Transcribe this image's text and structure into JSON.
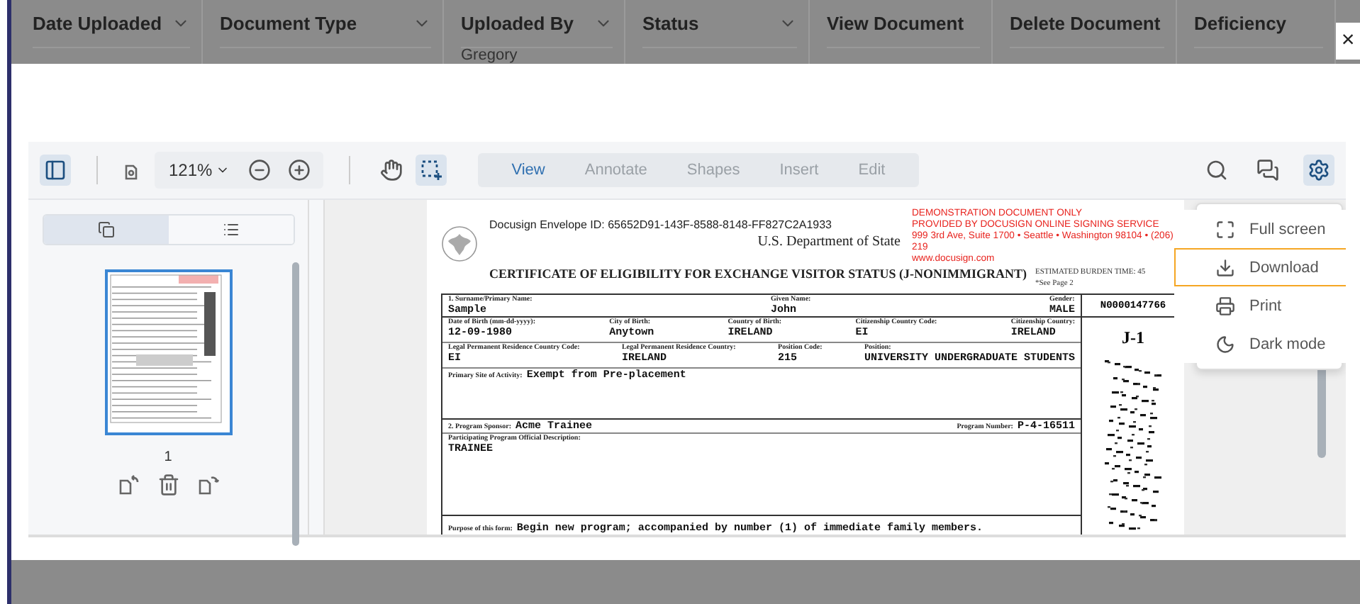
{
  "background_table": {
    "columns": [
      {
        "label": "Date Uploaded",
        "sortable": true
      },
      {
        "label": "Document Type",
        "sortable": true
      },
      {
        "label": "Uploaded By",
        "sortable": true
      },
      {
        "label": "Status",
        "sortable": true
      },
      {
        "label": "View Document",
        "sortable": false
      },
      {
        "label": "Delete Document",
        "sortable": false
      },
      {
        "label": "Deficiency",
        "sortable": false
      }
    ],
    "cell": "Gregory"
  },
  "close_button": "×",
  "toolbar": {
    "panel_tools": [
      {
        "kind": "sidebar",
        "selected": true
      }
    ],
    "zoom": "121%",
    "hand_tools": [
      {
        "kind": "pan",
        "selected": false
      },
      {
        "kind": "select",
        "selected": true
      }
    ],
    "modes": [
      {
        "label": "View",
        "selected": true
      },
      {
        "label": "Annotate",
        "selected": false
      },
      {
        "label": "Shapes",
        "selected": false
      },
      {
        "label": "Insert",
        "selected": false
      },
      {
        "label": "Edit",
        "selected": false
      }
    ],
    "right_tools": [
      {
        "kind": "search",
        "selected": false
      },
      {
        "kind": "comments",
        "selected": false
      },
      {
        "kind": "settings",
        "selected": true
      }
    ]
  },
  "sidebar": {
    "tabs": [
      {
        "kind": "thumbnails",
        "selected": true
      },
      {
        "kind": "outline",
        "selected": false
      }
    ],
    "pages": [
      {
        "number": "1",
        "selected": true
      }
    ]
  },
  "document": {
    "envelope": "Docusign Envelope ID: 65652D91-143F-8588-8148-FF827C2A1933",
    "department": "U.S. Department of State",
    "title": "CERTIFICATE OF ELIGIBILITY FOR EXCHANGE VISITOR STATUS (J-NONIMMIGRANT)",
    "watermark_lines": [
      "DEMONSTRATION DOCUMENT ONLY",
      "PROVIDED BY DOCUSIGN ONLINE SIGNING SERVICE",
      "999 3rd Ave, Suite 1700 • Seattle • Washington 98104 • (206) 219",
      "www.docusign.com"
    ],
    "side_notes": [
      "ESTIMATED BURDEN TIME: 45",
      "*See Page 2"
    ],
    "lines": [
      {
        "fields": [
          {
            "label": "1. Surname/Primary Name:",
            "value": "Sample"
          },
          {
            "label": "Given Name:",
            "value": "John"
          },
          {
            "label": "Gender:",
            "value": "MALE"
          }
        ]
      },
      {
        "fields": [
          {
            "label": "Date of Birth (mm-dd-yyyy):",
            "value": "12-09-1980"
          },
          {
            "label": "City of Birth:",
            "value": "Anytown"
          },
          {
            "label": "Country of Birth:",
            "value": "IRELAND"
          },
          {
            "label": "Citizenship Country Code:",
            "value": "EI"
          },
          {
            "label": "Citizenship Country:",
            "value": "IRELAND"
          }
        ]
      },
      {
        "fields": [
          {
            "label": "Legal Permanent Residence Country Code:",
            "value": "EI"
          },
          {
            "label": "Legal Permanent Residence Country:",
            "value": "IRELAND"
          },
          {
            "label": "Position Code:",
            "value": "215"
          },
          {
            "label": "Position:",
            "value": "UNIVERSITY UNDERGRADUATE STUDENTS"
          }
        ]
      }
    ],
    "site": {
      "label": "Primary Site of Activity:",
      "value": "Exempt from Pre-placement"
    },
    "sponsor": {
      "label": "2. Program Sponsor:",
      "value": "Acme Trainee"
    },
    "program_number": {
      "label": "Program Number:",
      "value": "P-4-16511"
    },
    "description": {
      "label": "Participating Program Official Description:",
      "value": "TRAINEE"
    },
    "purpose": {
      "label": "Purpose of this form:",
      "value": "Begin new program; accompanied by number (1) of immediate family members."
    },
    "sevis_id": "N0000147766",
    "visa_type": "J-1"
  },
  "menu": {
    "items": [
      {
        "kind": "fullscreen",
        "label": "Full screen",
        "highlighted": false
      },
      {
        "kind": "download",
        "label": "Download",
        "highlighted": true
      },
      {
        "kind": "print",
        "label": "Print",
        "highlighted": false
      },
      {
        "kind": "darkmode",
        "label": "Dark mode",
        "highlighted": false
      }
    ]
  }
}
